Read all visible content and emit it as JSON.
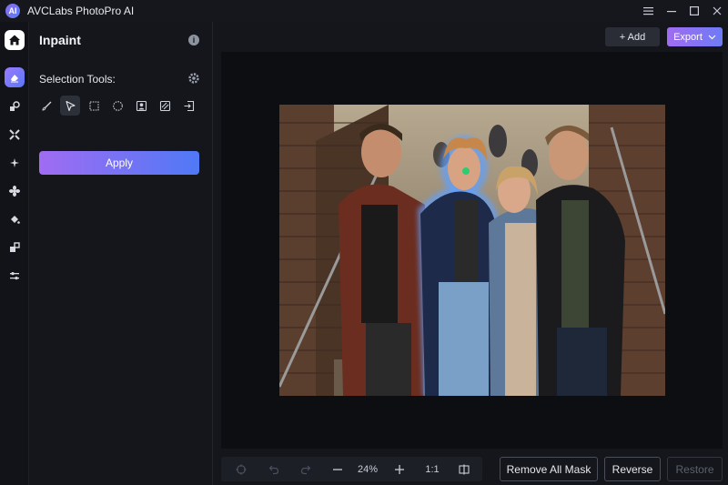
{
  "window": {
    "title": "AVCLabs PhotoPro AI",
    "logo_text": "AI"
  },
  "panel": {
    "title": "Inpaint",
    "selection_label": "Selection Tools:",
    "apply_label": "Apply",
    "tools": [
      "brush-tool",
      "pointer-tool",
      "rect-select-tool",
      "ellipse-select-tool",
      "person-select-tool",
      "pattern-select-tool",
      "import-mask-tool"
    ],
    "selected_tool_index": 1
  },
  "header": {
    "add_label": "+ Add",
    "export_label": "Export"
  },
  "rail": {
    "items": [
      "home",
      "inpaint",
      "shapes",
      "upscale",
      "enhance",
      "fan",
      "paint-bucket",
      "crop",
      "adjust"
    ],
    "active_index": 0,
    "accent_index": 1
  },
  "bottom": {
    "zoom": "24%",
    "ratio": "1:1",
    "remove_mask_label": "Remove All Mask",
    "reverse_label": "Reverse",
    "restore_label": "Restore"
  },
  "colors": {
    "accent_start": "#a06cf2",
    "accent_end": "#4f79f6",
    "mask_glow": "#5fa0ff",
    "brush_dot": "#2ecc71"
  }
}
